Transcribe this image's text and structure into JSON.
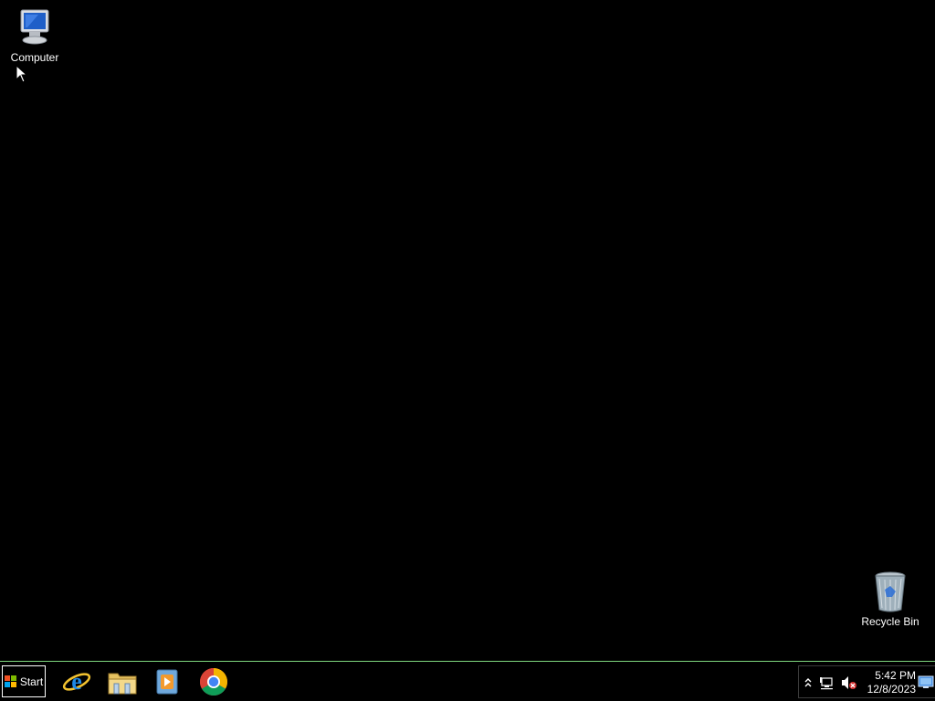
{
  "desktop": {
    "background_color": "#000000",
    "icons": [
      {
        "label": "Computer",
        "icon": "computer-icon"
      },
      {
        "label": "Recycle Bin",
        "icon": "recycle-bin-icon"
      }
    ]
  },
  "taskbar": {
    "border_color": "#7fd77f",
    "start_label": "Start",
    "pinned": [
      {
        "icon": "internet-explorer-icon"
      },
      {
        "icon": "file-explorer-icon"
      },
      {
        "icon": "media-player-icon"
      },
      {
        "icon": "chrome-icon"
      }
    ],
    "tray": {
      "icons": [
        "show-hidden-icons-chevron",
        "network-icon",
        "volume-muted-icon"
      ],
      "time": "5:42 PM",
      "date": "12/8/2023"
    }
  }
}
